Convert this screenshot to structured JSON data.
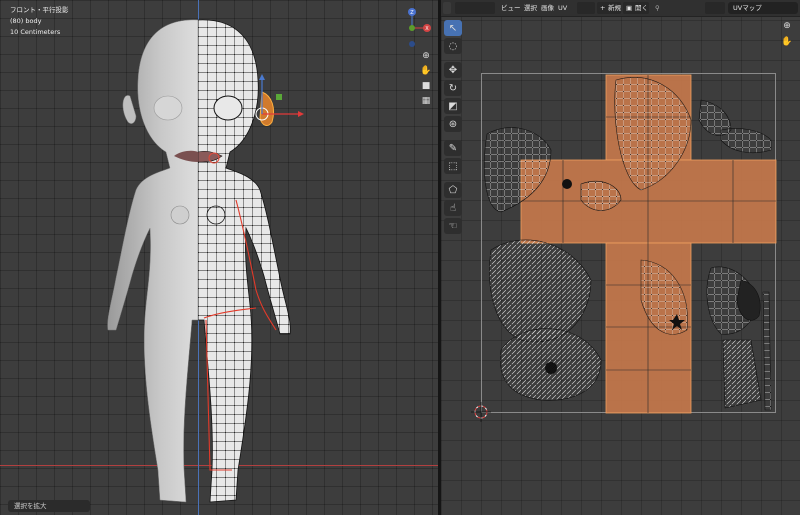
{
  "viewport": {
    "info_lines": [
      "フロント・平行投影",
      "(80) body",
      "10 Centimeters"
    ],
    "status_tip": "選択を拡大",
    "gizmo": {
      "x_label": "X",
      "y_label": "Y",
      "z_label": "Z"
    },
    "nav_icons": [
      "zoom-icon",
      "hand-icon",
      "camera-icon",
      "grid-icon"
    ]
  },
  "uv_editor": {
    "header": {
      "menus": [
        "ビュー",
        "選択",
        "画像",
        "UV"
      ],
      "new_label": "新規",
      "open_label": "開く",
      "uv_map": "UVマップ"
    },
    "tools": [
      "select-tool",
      "select-circle-tool",
      "move-tool",
      "rotate-tool",
      "scale-tool",
      "transform-tool",
      "annotate-tool",
      "cursor-tool",
      "grab-tool",
      "relax-tool",
      "pinch-tool"
    ]
  },
  "colors": {
    "accent": "#4772b3",
    "uv_face": "#c8794b",
    "selection": "#f08a20",
    "axis_x": "#b24040",
    "axis_y": "#5c9c2c",
    "axis_z": "#4a72b8"
  }
}
